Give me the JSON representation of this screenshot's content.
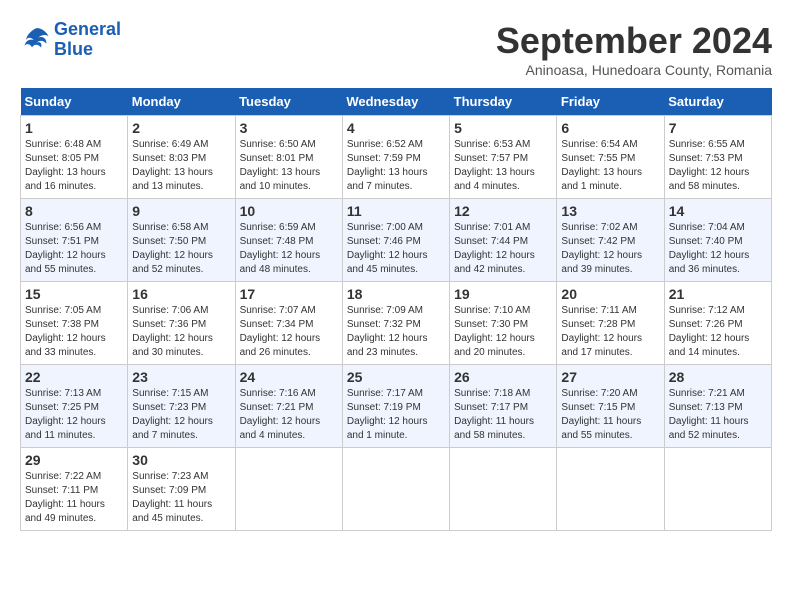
{
  "header": {
    "logo_line1": "General",
    "logo_line2": "Blue",
    "month_title": "September 2024",
    "subtitle": "Aninoasa, Hunedoara County, Romania"
  },
  "calendar": {
    "columns": [
      "Sunday",
      "Monday",
      "Tuesday",
      "Wednesday",
      "Thursday",
      "Friday",
      "Saturday"
    ],
    "weeks": [
      [
        {
          "day": "",
          "info": ""
        },
        {
          "day": "2",
          "info": "Sunrise: 6:49 AM\nSunset: 8:03 PM\nDaylight: 13 hours\nand 13 minutes."
        },
        {
          "day": "3",
          "info": "Sunrise: 6:50 AM\nSunset: 8:01 PM\nDaylight: 13 hours\nand 10 minutes."
        },
        {
          "day": "4",
          "info": "Sunrise: 6:52 AM\nSunset: 7:59 PM\nDaylight: 13 hours\nand 7 minutes."
        },
        {
          "day": "5",
          "info": "Sunrise: 6:53 AM\nSunset: 7:57 PM\nDaylight: 13 hours\nand 4 minutes."
        },
        {
          "day": "6",
          "info": "Sunrise: 6:54 AM\nSunset: 7:55 PM\nDaylight: 13 hours\nand 1 minute."
        },
        {
          "day": "7",
          "info": "Sunrise: 6:55 AM\nSunset: 7:53 PM\nDaylight: 12 hours\nand 58 minutes."
        }
      ],
      [
        {
          "day": "1",
          "info": "Sunrise: 6:48 AM\nSunset: 8:05 PM\nDaylight: 13 hours\nand 16 minutes."
        },
        {
          "day": "",
          "info": ""
        },
        {
          "day": "",
          "info": ""
        },
        {
          "day": "",
          "info": ""
        },
        {
          "day": "",
          "info": ""
        },
        {
          "day": "",
          "info": ""
        },
        {
          "day": "",
          "info": ""
        }
      ],
      [
        {
          "day": "8",
          "info": "Sunrise: 6:56 AM\nSunset: 7:51 PM\nDaylight: 12 hours\nand 55 minutes."
        },
        {
          "day": "9",
          "info": "Sunrise: 6:58 AM\nSunset: 7:50 PM\nDaylight: 12 hours\nand 52 minutes."
        },
        {
          "day": "10",
          "info": "Sunrise: 6:59 AM\nSunset: 7:48 PM\nDaylight: 12 hours\nand 48 minutes."
        },
        {
          "day": "11",
          "info": "Sunrise: 7:00 AM\nSunset: 7:46 PM\nDaylight: 12 hours\nand 45 minutes."
        },
        {
          "day": "12",
          "info": "Sunrise: 7:01 AM\nSunset: 7:44 PM\nDaylight: 12 hours\nand 42 minutes."
        },
        {
          "day": "13",
          "info": "Sunrise: 7:02 AM\nSunset: 7:42 PM\nDaylight: 12 hours\nand 39 minutes."
        },
        {
          "day": "14",
          "info": "Sunrise: 7:04 AM\nSunset: 7:40 PM\nDaylight: 12 hours\nand 36 minutes."
        }
      ],
      [
        {
          "day": "15",
          "info": "Sunrise: 7:05 AM\nSunset: 7:38 PM\nDaylight: 12 hours\nand 33 minutes."
        },
        {
          "day": "16",
          "info": "Sunrise: 7:06 AM\nSunset: 7:36 PM\nDaylight: 12 hours\nand 30 minutes."
        },
        {
          "day": "17",
          "info": "Sunrise: 7:07 AM\nSunset: 7:34 PM\nDaylight: 12 hours\nand 26 minutes."
        },
        {
          "day": "18",
          "info": "Sunrise: 7:09 AM\nSunset: 7:32 PM\nDaylight: 12 hours\nand 23 minutes."
        },
        {
          "day": "19",
          "info": "Sunrise: 7:10 AM\nSunset: 7:30 PM\nDaylight: 12 hours\nand 20 minutes."
        },
        {
          "day": "20",
          "info": "Sunrise: 7:11 AM\nSunset: 7:28 PM\nDaylight: 12 hours\nand 17 minutes."
        },
        {
          "day": "21",
          "info": "Sunrise: 7:12 AM\nSunset: 7:26 PM\nDaylight: 12 hours\nand 14 minutes."
        }
      ],
      [
        {
          "day": "22",
          "info": "Sunrise: 7:13 AM\nSunset: 7:25 PM\nDaylight: 12 hours\nand 11 minutes."
        },
        {
          "day": "23",
          "info": "Sunrise: 7:15 AM\nSunset: 7:23 PM\nDaylight: 12 hours\nand 7 minutes."
        },
        {
          "day": "24",
          "info": "Sunrise: 7:16 AM\nSunset: 7:21 PM\nDaylight: 12 hours\nand 4 minutes."
        },
        {
          "day": "25",
          "info": "Sunrise: 7:17 AM\nSunset: 7:19 PM\nDaylight: 12 hours\nand 1 minute."
        },
        {
          "day": "26",
          "info": "Sunrise: 7:18 AM\nSunset: 7:17 PM\nDaylight: 11 hours\nand 58 minutes."
        },
        {
          "day": "27",
          "info": "Sunrise: 7:20 AM\nSunset: 7:15 PM\nDaylight: 11 hours\nand 55 minutes."
        },
        {
          "day": "28",
          "info": "Sunrise: 7:21 AM\nSunset: 7:13 PM\nDaylight: 11 hours\nand 52 minutes."
        }
      ],
      [
        {
          "day": "29",
          "info": "Sunrise: 7:22 AM\nSunset: 7:11 PM\nDaylight: 11 hours\nand 49 minutes."
        },
        {
          "day": "30",
          "info": "Sunrise: 7:23 AM\nSunset: 7:09 PM\nDaylight: 11 hours\nand 45 minutes."
        },
        {
          "day": "",
          "info": ""
        },
        {
          "day": "",
          "info": ""
        },
        {
          "day": "",
          "info": ""
        },
        {
          "day": "",
          "info": ""
        },
        {
          "day": "",
          "info": ""
        }
      ]
    ]
  }
}
